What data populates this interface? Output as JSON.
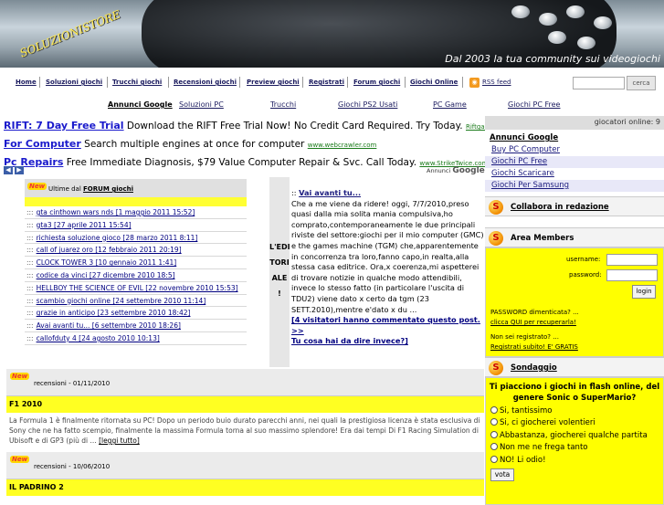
{
  "banner": {
    "logo": "SOLUZIONISTORE",
    "tagline": "Dal 2003 la tua community sui videogiochi"
  },
  "nav1": [
    "Home",
    "Soluzioni giochi",
    "Trucchi giochi",
    "Recensioni giochi",
    "Preview giochi",
    "Registrati",
    "Forum giochi",
    "Giochi Online"
  ],
  "rss": "RSS feed",
  "search": {
    "button": "cerca"
  },
  "nav2": [
    "Annunci Google",
    "Soluzioni PC",
    "Trucchi",
    "Giochi PS2 Usati",
    "PC Game",
    "Giochi PC Free"
  ],
  "ads": [
    {
      "title": "RIFT: 7 Day Free Trial",
      "text": "Download the RIFT Free Trial Now! No Credit Card Required. Try Today.",
      "url": "Riftgame.com/FreeTri"
    },
    {
      "title": "For Computer",
      "text": "Search multiple engines at once for computer",
      "url": "www.webcrawler.com"
    },
    {
      "title": "Pc Repairs",
      "text": "Free Immediate Diagnosis, $79 Value Computer Repair & Svc. Call Today.",
      "url": "www.StrikeTwice.com"
    }
  ],
  "ads_by": {
    "pre": "Annunci",
    "brand": "Google"
  },
  "new_badge": "New",
  "forum": {
    "title_pre": "Ultime dal ",
    "title_link": "FORUM giochi",
    "bullet": ":::",
    "items": [
      "gta cinthown wars nds [1 maggio 2011 15:52]",
      "gta3 [27 aprile 2011 15:54]",
      "richiesta soluzione gioco [28 marzo 2011 8:11]",
      "call of juarez oro [12 febbraio 2011 20:19]",
      "CLOCK TOWER 3 [10 gennaio 2011 1:41]",
      "codice da vinci [27 dicembre 2010 18:5]",
      "HELLBOY THE SCIENCE OF EVIL [22 novembre 2010 15:53]",
      "scambio giochi online [24 settembre 2010 11:14]",
      "grazie in anticipo [23 settembre 2010 18:42]",
      "Avai avanti tu... [6 settembre 2010 18:26]",
      "callofduty 4 [24 agosto 2010 10:13]"
    ]
  },
  "editoriale": {
    "label": [
      "L'EDI",
      "TORI",
      "ALE",
      "!"
    ],
    "prefix": ":: ",
    "title": "Vai avanti tu...",
    "body": "Che a me viene da ridere! oggi, 7/7/2010,preso quasi dalla mia solita mania compulsiva,ho comprato,contemporaneamente le due principali riviste del settore:giochi per il mio computer (GMC) e the games machine (TGM) che,apparentemente in concorrenza tra loro,fanno capo,in realta,alla stessa casa editrice. Ora,x coerenza,mi aspetterei di trovare notizie in qualche modo attendibili, invece lo stesso fatto (in particolare l'uscita di TDU2) viene dato x certo da tgm (23 SETT.2010),mentre e'dato x du ...",
    "more1": "[4 visitatori hanno commentato questo post. >>",
    "more2": "Tu cosa hai da dire invece?]"
  },
  "news": [
    {
      "cat": "recensioni",
      "date": " - 01/11/2010",
      "title": "F1 2010",
      "text": "La Formula 1 è finalmente ritornata su PC! Dopo un periodo buio durato parecchi anni, nei quali la prestigiosa licenza è stata esclusiva di Sony che ne ha fatto scempio, finalmente la massima Formula torna al suo massimo splendore! Era dai tempi Di F1 Racing Simulation di Ubisoft e di GP3 (più di ...",
      "link": "[leggi tutto]"
    },
    {
      "cat": "recensioni",
      "date": " - 10/06/2010",
      "title": "IL PADRINO 2",
      "text": "",
      "link": ""
    }
  ],
  "side": {
    "online": "giocatori online: 9",
    "ann": "Annunci Google",
    "links": [
      "Buy PC Computer",
      "Giochi PC Free",
      "Giochi Scaricare",
      "Giochi Per Samsung"
    ],
    "collab": "Collabora in redazione",
    "area": "Area Members",
    "login": {
      "user": "username:",
      "pass": "password:",
      "btn": "login",
      "forgot": "PASSWORD dimenticata? ...",
      "forgot_link": "clicca QUI per recuperarla!",
      "notreg": "Non sei registrato? ...",
      "reg_link": "Registrati subito! E' GRATIS"
    },
    "sondaggio": "Sondaggio",
    "poll": {
      "q": "Ti piacciono i giochi in flash online, del genere Sonic o SuperMario?",
      "opts": [
        "Si, tantissimo",
        "Si, ci giocherei volentieri",
        "Abbastanza, giocherei qualche partita",
        "Non me ne frega tanto",
        "NO! Li odio!"
      ],
      "vote": "vota"
    }
  }
}
